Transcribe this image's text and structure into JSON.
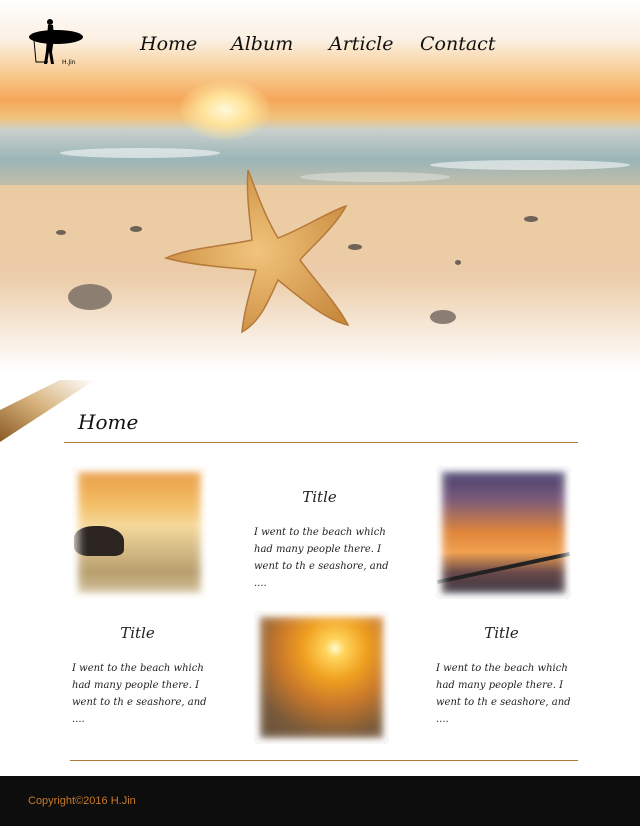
{
  "nav": {
    "logo_text": "H.Jin",
    "items": [
      "Home",
      "Album",
      "Article",
      "Contact"
    ]
  },
  "main": {
    "heading": "Home",
    "cards": [
      {
        "title": "Title",
        "text": "I went to the beach which had many people there. I went to th e seashore, and ...."
      },
      {
        "title": "Title",
        "text": "I went to the beach which had many people there. I went to th e seashore, and ...."
      },
      {
        "title": "Title",
        "text": "I went to the beach which had many people there. I went to th e seashore, and ...."
      }
    ]
  },
  "footer": {
    "copyright": "Copyright©2016 H.Jin"
  },
  "colors": {
    "accent": "#c77a2a",
    "rule": "#b07a3a",
    "footer_bg": "#0d0d0d"
  }
}
